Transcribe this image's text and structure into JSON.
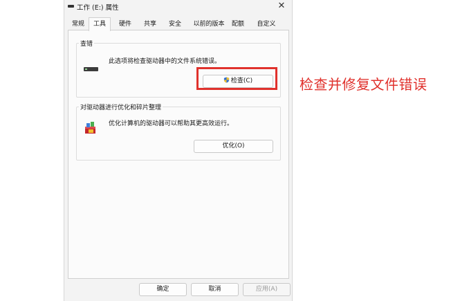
{
  "window": {
    "title": "工作 (E:) 属性",
    "close_glyph": "✕"
  },
  "tabs": [
    {
      "label": "常规",
      "active": false
    },
    {
      "label": "工具",
      "active": true
    },
    {
      "label": "硬件",
      "active": false
    },
    {
      "label": "共享",
      "active": false
    },
    {
      "label": "安全",
      "active": false
    },
    {
      "label": "以前的版本",
      "active": false
    },
    {
      "label": "配额",
      "active": false
    },
    {
      "label": "自定义",
      "active": false
    }
  ],
  "error_check": {
    "group_title": "查错",
    "description": "此选项将检查驱动器中的文件系统错误。",
    "button_label": "检查(C)",
    "icon": "drive-icon"
  },
  "optimize": {
    "group_title": "对驱动器进行优化和碎片整理",
    "description": "优化计算机的驱动器可以帮助其更高效运行。",
    "button_label": "优化(O)",
    "icon": "defrag-icon"
  },
  "footer": {
    "ok_label": "确定",
    "cancel_label": "取消",
    "apply_label": "应用(A)"
  },
  "annotation": {
    "text": "检查并修复文件错误",
    "color": "#e0312c"
  }
}
